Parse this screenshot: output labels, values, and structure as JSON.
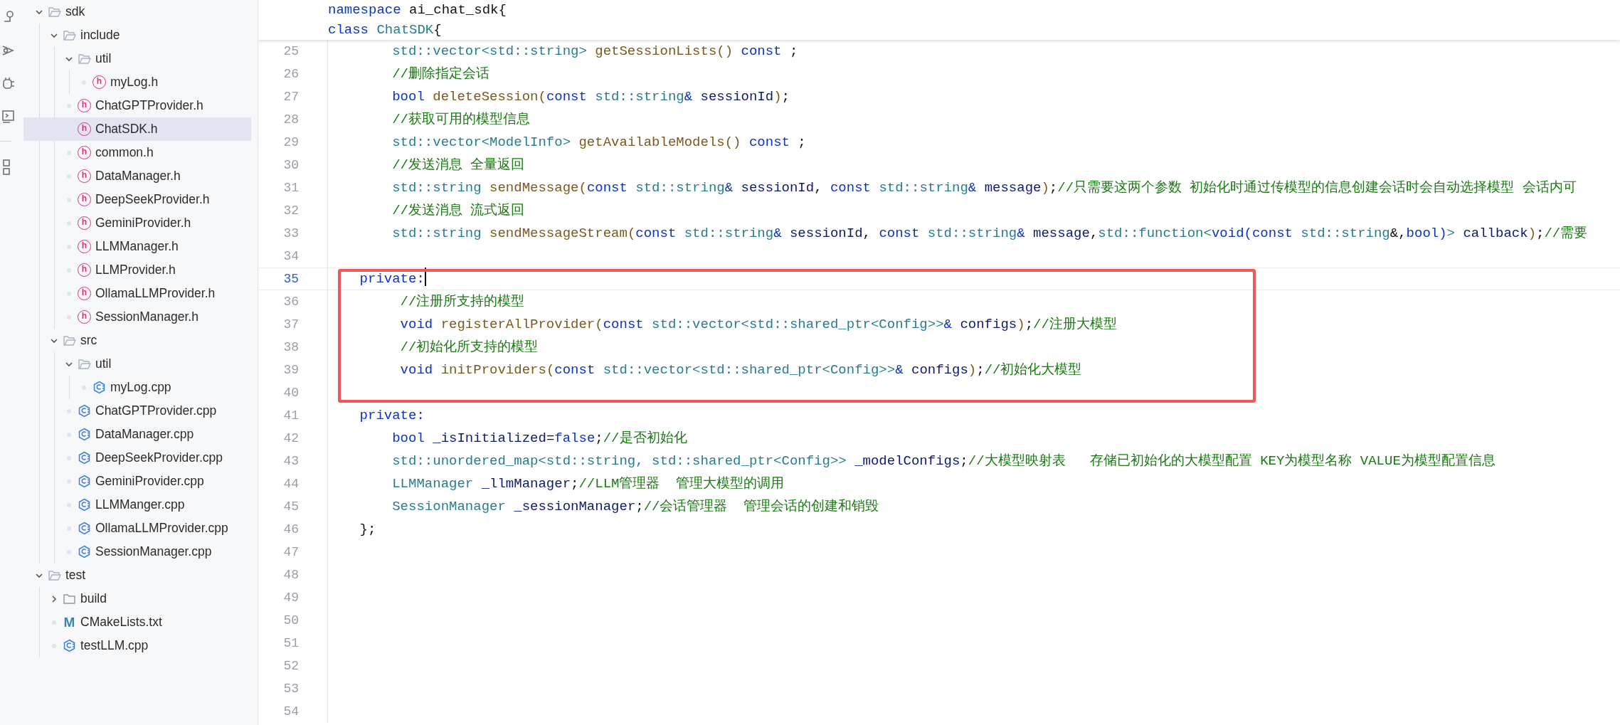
{
  "explorer": {
    "tree": [
      {
        "name": "sdk",
        "kind": "folder",
        "expanded": true,
        "selected": false,
        "children": [
          {
            "name": "include",
            "kind": "folder",
            "expanded": true,
            "selected": false,
            "children": [
              {
                "name": "util",
                "kind": "folder",
                "expanded": true,
                "selected": false,
                "children": [
                  {
                    "name": "myLog.h",
                    "kind": "header",
                    "badge": "h",
                    "selected": false
                  }
                ]
              },
              {
                "name": "ChatGPTProvider.h",
                "kind": "header",
                "badge": "h",
                "selected": false
              },
              {
                "name": "ChatSDK.h",
                "kind": "header",
                "badge": "h",
                "selected": true
              },
              {
                "name": "common.h",
                "kind": "header",
                "badge": "h",
                "selected": false
              },
              {
                "name": "DataManager.h",
                "kind": "header",
                "badge": "h",
                "selected": false
              },
              {
                "name": "DeepSeekProvider.h",
                "kind": "header",
                "badge": "h",
                "selected": false
              },
              {
                "name": "GeminiProvider.h",
                "kind": "header",
                "badge": "h",
                "selected": false
              },
              {
                "name": "LLMManager.h",
                "kind": "header",
                "badge": "h",
                "selected": false
              },
              {
                "name": "LLMProvider.h",
                "kind": "header",
                "badge": "h",
                "selected": false
              },
              {
                "name": "OllamaLLMProvider.h",
                "kind": "header",
                "badge": "h",
                "selected": false
              },
              {
                "name": "SessionManager.h",
                "kind": "header",
                "badge": "h",
                "selected": false
              }
            ]
          },
          {
            "name": "src",
            "kind": "folder",
            "expanded": true,
            "selected": false,
            "children": [
              {
                "name": "util",
                "kind": "folder",
                "expanded": true,
                "selected": false,
                "children": [
                  {
                    "name": "myLog.cpp",
                    "kind": "source",
                    "selected": false
                  }
                ]
              },
              {
                "name": "ChatGPTProvider.cpp",
                "kind": "source",
                "selected": false
              },
              {
                "name": "DataManager.cpp",
                "kind": "source",
                "selected": false
              },
              {
                "name": "DeepSeekProvider.cpp",
                "kind": "source",
                "selected": false
              },
              {
                "name": "GeminiProvider.cpp",
                "kind": "source",
                "selected": false
              },
              {
                "name": "LLMManger.cpp",
                "kind": "source",
                "selected": false
              },
              {
                "name": "OllamaLLMProvider.cpp",
                "kind": "source",
                "selected": false
              },
              {
                "name": "SessionManager.cpp",
                "kind": "source",
                "selected": false
              }
            ]
          }
        ]
      },
      {
        "name": "test",
        "kind": "folder",
        "expanded": true,
        "selected": false,
        "children": [
          {
            "name": "build",
            "kind": "folder",
            "expanded": false,
            "selected": false
          },
          {
            "name": "CMakeLists.txt",
            "kind": "cmake",
            "badge": "M",
            "selected": false
          },
          {
            "name": "testLLM.cpp",
            "kind": "source",
            "selected": false
          }
        ]
      }
    ]
  },
  "editor": {
    "sticky_lines": [
      {
        "tokens": [
          {
            "text": "namespace ",
            "kind": "keyword"
          },
          {
            "text": "ai_chat_sdk{",
            "kind": "plain"
          }
        ]
      },
      {
        "tokens": [
          {
            "text": "class ",
            "kind": "keyword"
          },
          {
            "text": "ChatSDK",
            "kind": "type"
          },
          {
            "text": "{",
            "kind": "plain"
          }
        ]
      }
    ],
    "lines": [
      {
        "number": "25",
        "current": false,
        "boxed": false,
        "tokens": [
          {
            "text": "        std::vector<std::string> ",
            "kind": "type"
          },
          {
            "text": "getSessionLists",
            "kind": "function"
          },
          {
            "text": "() ",
            "kind": "paren"
          },
          {
            "text": "const",
            "kind": "keyword"
          },
          {
            "text": " ;",
            "kind": "plain"
          }
        ]
      },
      {
        "number": "26",
        "current": false,
        "boxed": false,
        "tokens": [
          {
            "text": "        //删除指定会话",
            "kind": "comment"
          }
        ]
      },
      {
        "number": "27",
        "current": false,
        "boxed": false,
        "tokens": [
          {
            "text": "        bool ",
            "kind": "keyword"
          },
          {
            "text": "deleteSession",
            "kind": "function"
          },
          {
            "text": "(",
            "kind": "paren"
          },
          {
            "text": "const ",
            "kind": "keyword"
          },
          {
            "text": "std::string",
            "kind": "type"
          },
          {
            "text": "& ",
            "kind": "keyword"
          },
          {
            "text": "sessionId",
            "kind": "name"
          },
          {
            "text": ")",
            "kind": "paren"
          },
          {
            "text": ";",
            "kind": "plain"
          }
        ]
      },
      {
        "number": "28",
        "current": false,
        "boxed": false,
        "tokens": [
          {
            "text": "        //获取可用的模型信息",
            "kind": "comment"
          }
        ]
      },
      {
        "number": "29",
        "current": false,
        "boxed": false,
        "tokens": [
          {
            "text": "        std::vector<ModelInfo> ",
            "kind": "type"
          },
          {
            "text": "getAvailableModels",
            "kind": "function"
          },
          {
            "text": "() ",
            "kind": "paren"
          },
          {
            "text": "const",
            "kind": "keyword"
          },
          {
            "text": " ;",
            "kind": "plain"
          }
        ]
      },
      {
        "number": "30",
        "current": false,
        "boxed": false,
        "tokens": [
          {
            "text": "        //发送消息 全量返回",
            "kind": "comment"
          }
        ]
      },
      {
        "number": "31",
        "current": false,
        "boxed": false,
        "tokens": [
          {
            "text": "        std::string ",
            "kind": "type"
          },
          {
            "text": "sendMessage",
            "kind": "function"
          },
          {
            "text": "(",
            "kind": "paren"
          },
          {
            "text": "const ",
            "kind": "keyword"
          },
          {
            "text": "std::string",
            "kind": "type"
          },
          {
            "text": "& ",
            "kind": "keyword"
          },
          {
            "text": "sessionId",
            "kind": "name"
          },
          {
            "text": ", ",
            "kind": "plain"
          },
          {
            "text": "const ",
            "kind": "keyword"
          },
          {
            "text": "std::string",
            "kind": "type"
          },
          {
            "text": "& ",
            "kind": "keyword"
          },
          {
            "text": "message",
            "kind": "name"
          },
          {
            "text": ")",
            "kind": "paren"
          },
          {
            "text": ";",
            "kind": "plain"
          },
          {
            "text": "//只需要这两个参数 初始化时通过传模型的信息创建会话时会自动选择模型 会话内可",
            "kind": "comment"
          }
        ]
      },
      {
        "number": "32",
        "current": false,
        "boxed": false,
        "tokens": [
          {
            "text": "        //发送消息 流式返回",
            "kind": "comment"
          }
        ]
      },
      {
        "number": "33",
        "current": false,
        "boxed": false,
        "tokens": [
          {
            "text": "        std::string ",
            "kind": "type"
          },
          {
            "text": "sendMessageStream",
            "kind": "function"
          },
          {
            "text": "(",
            "kind": "paren"
          },
          {
            "text": "const ",
            "kind": "keyword"
          },
          {
            "text": "std::string",
            "kind": "type"
          },
          {
            "text": "& ",
            "kind": "keyword"
          },
          {
            "text": "sessionId",
            "kind": "name"
          },
          {
            "text": ", ",
            "kind": "plain"
          },
          {
            "text": "const ",
            "kind": "keyword"
          },
          {
            "text": "std::string",
            "kind": "type"
          },
          {
            "text": "& ",
            "kind": "keyword"
          },
          {
            "text": "message",
            "kind": "name"
          },
          {
            "text": ",",
            "kind": "plain"
          },
          {
            "text": "std::function<",
            "kind": "type"
          },
          {
            "text": "void(const ",
            "kind": "keyword"
          },
          {
            "text": "std::string",
            "kind": "type"
          },
          {
            "text": "&,",
            "kind": "plain"
          },
          {
            "text": "bool)",
            "kind": "keyword"
          },
          {
            "text": "> ",
            "kind": "type"
          },
          {
            "text": "callback",
            "kind": "name"
          },
          {
            "text": ")",
            "kind": "paren"
          },
          {
            "text": ";",
            "kind": "plain"
          },
          {
            "text": "//需要",
            "kind": "comment"
          }
        ]
      },
      {
        "number": "34",
        "current": false,
        "boxed": false
      },
      {
        "number": "35",
        "current": true,
        "boxed": true,
        "tokens": [
          {
            "text": "    private:",
            "kind": "keyword"
          }
        ]
      },
      {
        "number": "36",
        "current": false,
        "boxed": true,
        "tokens": [
          {
            "text": "         //注册所支持的模型",
            "kind": "comment"
          }
        ]
      },
      {
        "number": "37",
        "current": false,
        "boxed": true,
        "tokens": [
          {
            "text": "         void ",
            "kind": "keyword"
          },
          {
            "text": "registerAllProvider",
            "kind": "function"
          },
          {
            "text": "(",
            "kind": "paren"
          },
          {
            "text": "const ",
            "kind": "keyword"
          },
          {
            "text": "std::vector<std::shared_ptr<Config>>",
            "kind": "type"
          },
          {
            "text": "& ",
            "kind": "keyword"
          },
          {
            "text": "configs",
            "kind": "name"
          },
          {
            "text": ")",
            "kind": "paren"
          },
          {
            "text": ";",
            "kind": "plain"
          },
          {
            "text": "//注册大模型",
            "kind": "comment"
          }
        ]
      },
      {
        "number": "38",
        "current": false,
        "boxed": true,
        "tokens": [
          {
            "text": "         //初始化所支持的模型",
            "kind": "comment"
          }
        ]
      },
      {
        "number": "39",
        "current": false,
        "boxed": true,
        "tokens": [
          {
            "text": "         void ",
            "kind": "keyword"
          },
          {
            "text": "initProviders",
            "kind": "function"
          },
          {
            "text": "(",
            "kind": "paren"
          },
          {
            "text": "const ",
            "kind": "keyword"
          },
          {
            "text": "std::vector<std::shared_ptr<Config>>",
            "kind": "type"
          },
          {
            "text": "& ",
            "kind": "keyword"
          },
          {
            "text": "configs",
            "kind": "name"
          },
          {
            "text": ")",
            "kind": "paren"
          },
          {
            "text": ";",
            "kind": "plain"
          },
          {
            "text": "//初始化大模型",
            "kind": "comment"
          }
        ]
      },
      {
        "number": "40",
        "current": false,
        "boxed": true
      },
      {
        "number": "41",
        "current": false,
        "boxed": false,
        "tokens": [
          {
            "text": "    private:",
            "kind": "keyword"
          }
        ]
      },
      {
        "number": "42",
        "current": false,
        "boxed": false,
        "tokens": [
          {
            "text": "        bool ",
            "kind": "keyword"
          },
          {
            "text": "_isInitialized",
            "kind": "name"
          },
          {
            "text": "=",
            "kind": "plain"
          },
          {
            "text": "false",
            "kind": "keyword"
          },
          {
            "text": ";",
            "kind": "plain"
          },
          {
            "text": "//是否初始化",
            "kind": "comment"
          }
        ]
      },
      {
        "number": "43",
        "current": false,
        "boxed": false,
        "tokens": [
          {
            "text": "        std::unordered_map<std::string, std::shared_ptr<Config>> ",
            "kind": "type"
          },
          {
            "text": "_modelConfigs",
            "kind": "name"
          },
          {
            "text": ";",
            "kind": "plain"
          },
          {
            "text": "//大模型映射表   存储已初始化的大模型配置 KEY为模型名称 VALUE为模型配置信息",
            "kind": "comment"
          }
        ]
      },
      {
        "number": "44",
        "current": false,
        "boxed": false,
        "tokens": [
          {
            "text": "        LLMManager ",
            "kind": "type"
          },
          {
            "text": "_llmManager",
            "kind": "name"
          },
          {
            "text": ";",
            "kind": "plain"
          },
          {
            "text": "//LLM管理器  管理大模型的调用",
            "kind": "comment"
          }
        ]
      },
      {
        "number": "45",
        "current": false,
        "boxed": false,
        "tokens": [
          {
            "text": "        SessionManager ",
            "kind": "type"
          },
          {
            "text": "_sessionManager",
            "kind": "name"
          },
          {
            "text": ";",
            "kind": "plain"
          },
          {
            "text": "//会话管理器  管理会话的创建和销毁",
            "kind": "comment"
          }
        ]
      },
      {
        "number": "46",
        "current": false,
        "boxed": false,
        "tokens": [
          {
            "text": "    };",
            "kind": "plain"
          }
        ]
      },
      {
        "number": "47",
        "current": false,
        "boxed": false
      },
      {
        "number": "48",
        "current": false,
        "boxed": false
      },
      {
        "number": "49",
        "current": false,
        "boxed": false
      },
      {
        "number": "50",
        "current": false,
        "boxed": false
      },
      {
        "number": "51",
        "current": false,
        "boxed": false
      },
      {
        "number": "52",
        "current": false,
        "boxed": false
      },
      {
        "number": "53",
        "current": false,
        "boxed": false
      },
      {
        "number": "54",
        "current": false,
        "boxed": false
      }
    ]
  }
}
